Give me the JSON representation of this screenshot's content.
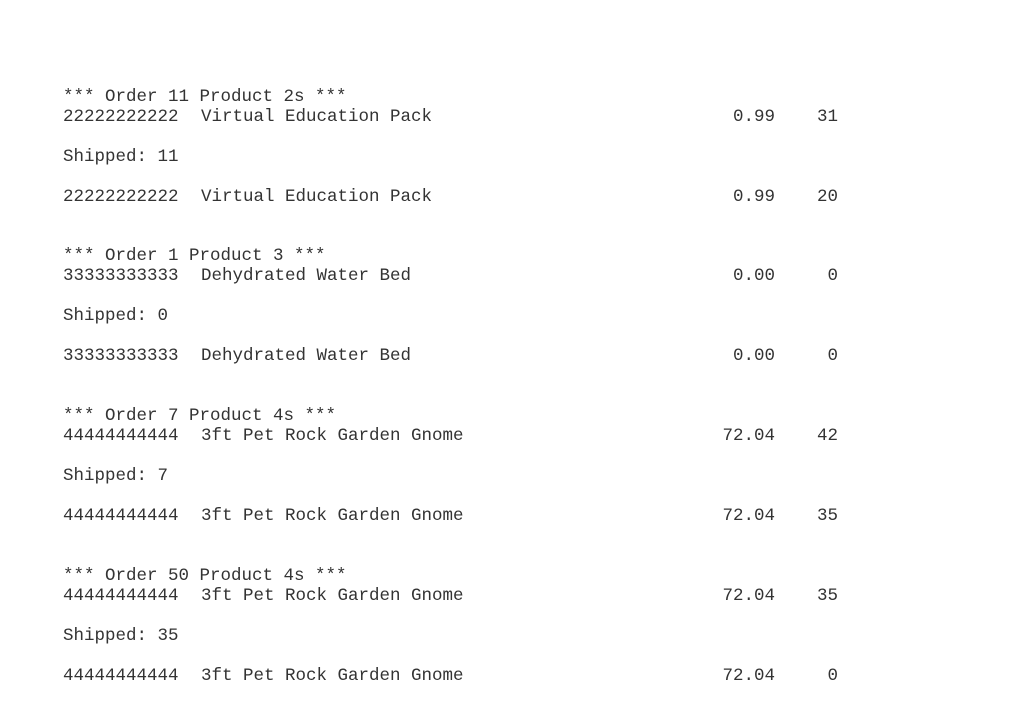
{
  "orders": [
    {
      "header": "*** Order 11 Product 2s ***",
      "ordered": {
        "sku": "22222222222",
        "name": "Virtual Education Pack",
        "price": "0.99",
        "qty": "31"
      },
      "shipped_label": "Shipped: 11",
      "remaining": {
        "sku": "22222222222",
        "name": "Virtual Education Pack",
        "price": "0.99",
        "qty": "20"
      }
    },
    {
      "header": "*** Order 1 Product 3 ***",
      "ordered": {
        "sku": "33333333333",
        "name": "Dehydrated Water Bed",
        "price": "0.00",
        "qty": "0"
      },
      "shipped_label": "Shipped: 0",
      "remaining": {
        "sku": "33333333333",
        "name": "Dehydrated Water Bed",
        "price": "0.00",
        "qty": "0"
      }
    },
    {
      "header": "*** Order 7 Product 4s ***",
      "ordered": {
        "sku": "44444444444",
        "name": "3ft Pet Rock Garden Gnome",
        "price": "72.04",
        "qty": "42"
      },
      "shipped_label": "Shipped: 7",
      "remaining": {
        "sku": "44444444444",
        "name": "3ft Pet Rock Garden Gnome",
        "price": "72.04",
        "qty": "35"
      }
    },
    {
      "header": "*** Order 50 Product 4s ***",
      "ordered": {
        "sku": "44444444444",
        "name": "3ft Pet Rock Garden Gnome",
        "price": "72.04",
        "qty": "35"
      },
      "shipped_label": "Shipped: 35",
      "remaining": {
        "sku": "44444444444",
        "name": "3ft Pet Rock Garden Gnome",
        "price": "72.04",
        "qty": "0"
      }
    }
  ]
}
